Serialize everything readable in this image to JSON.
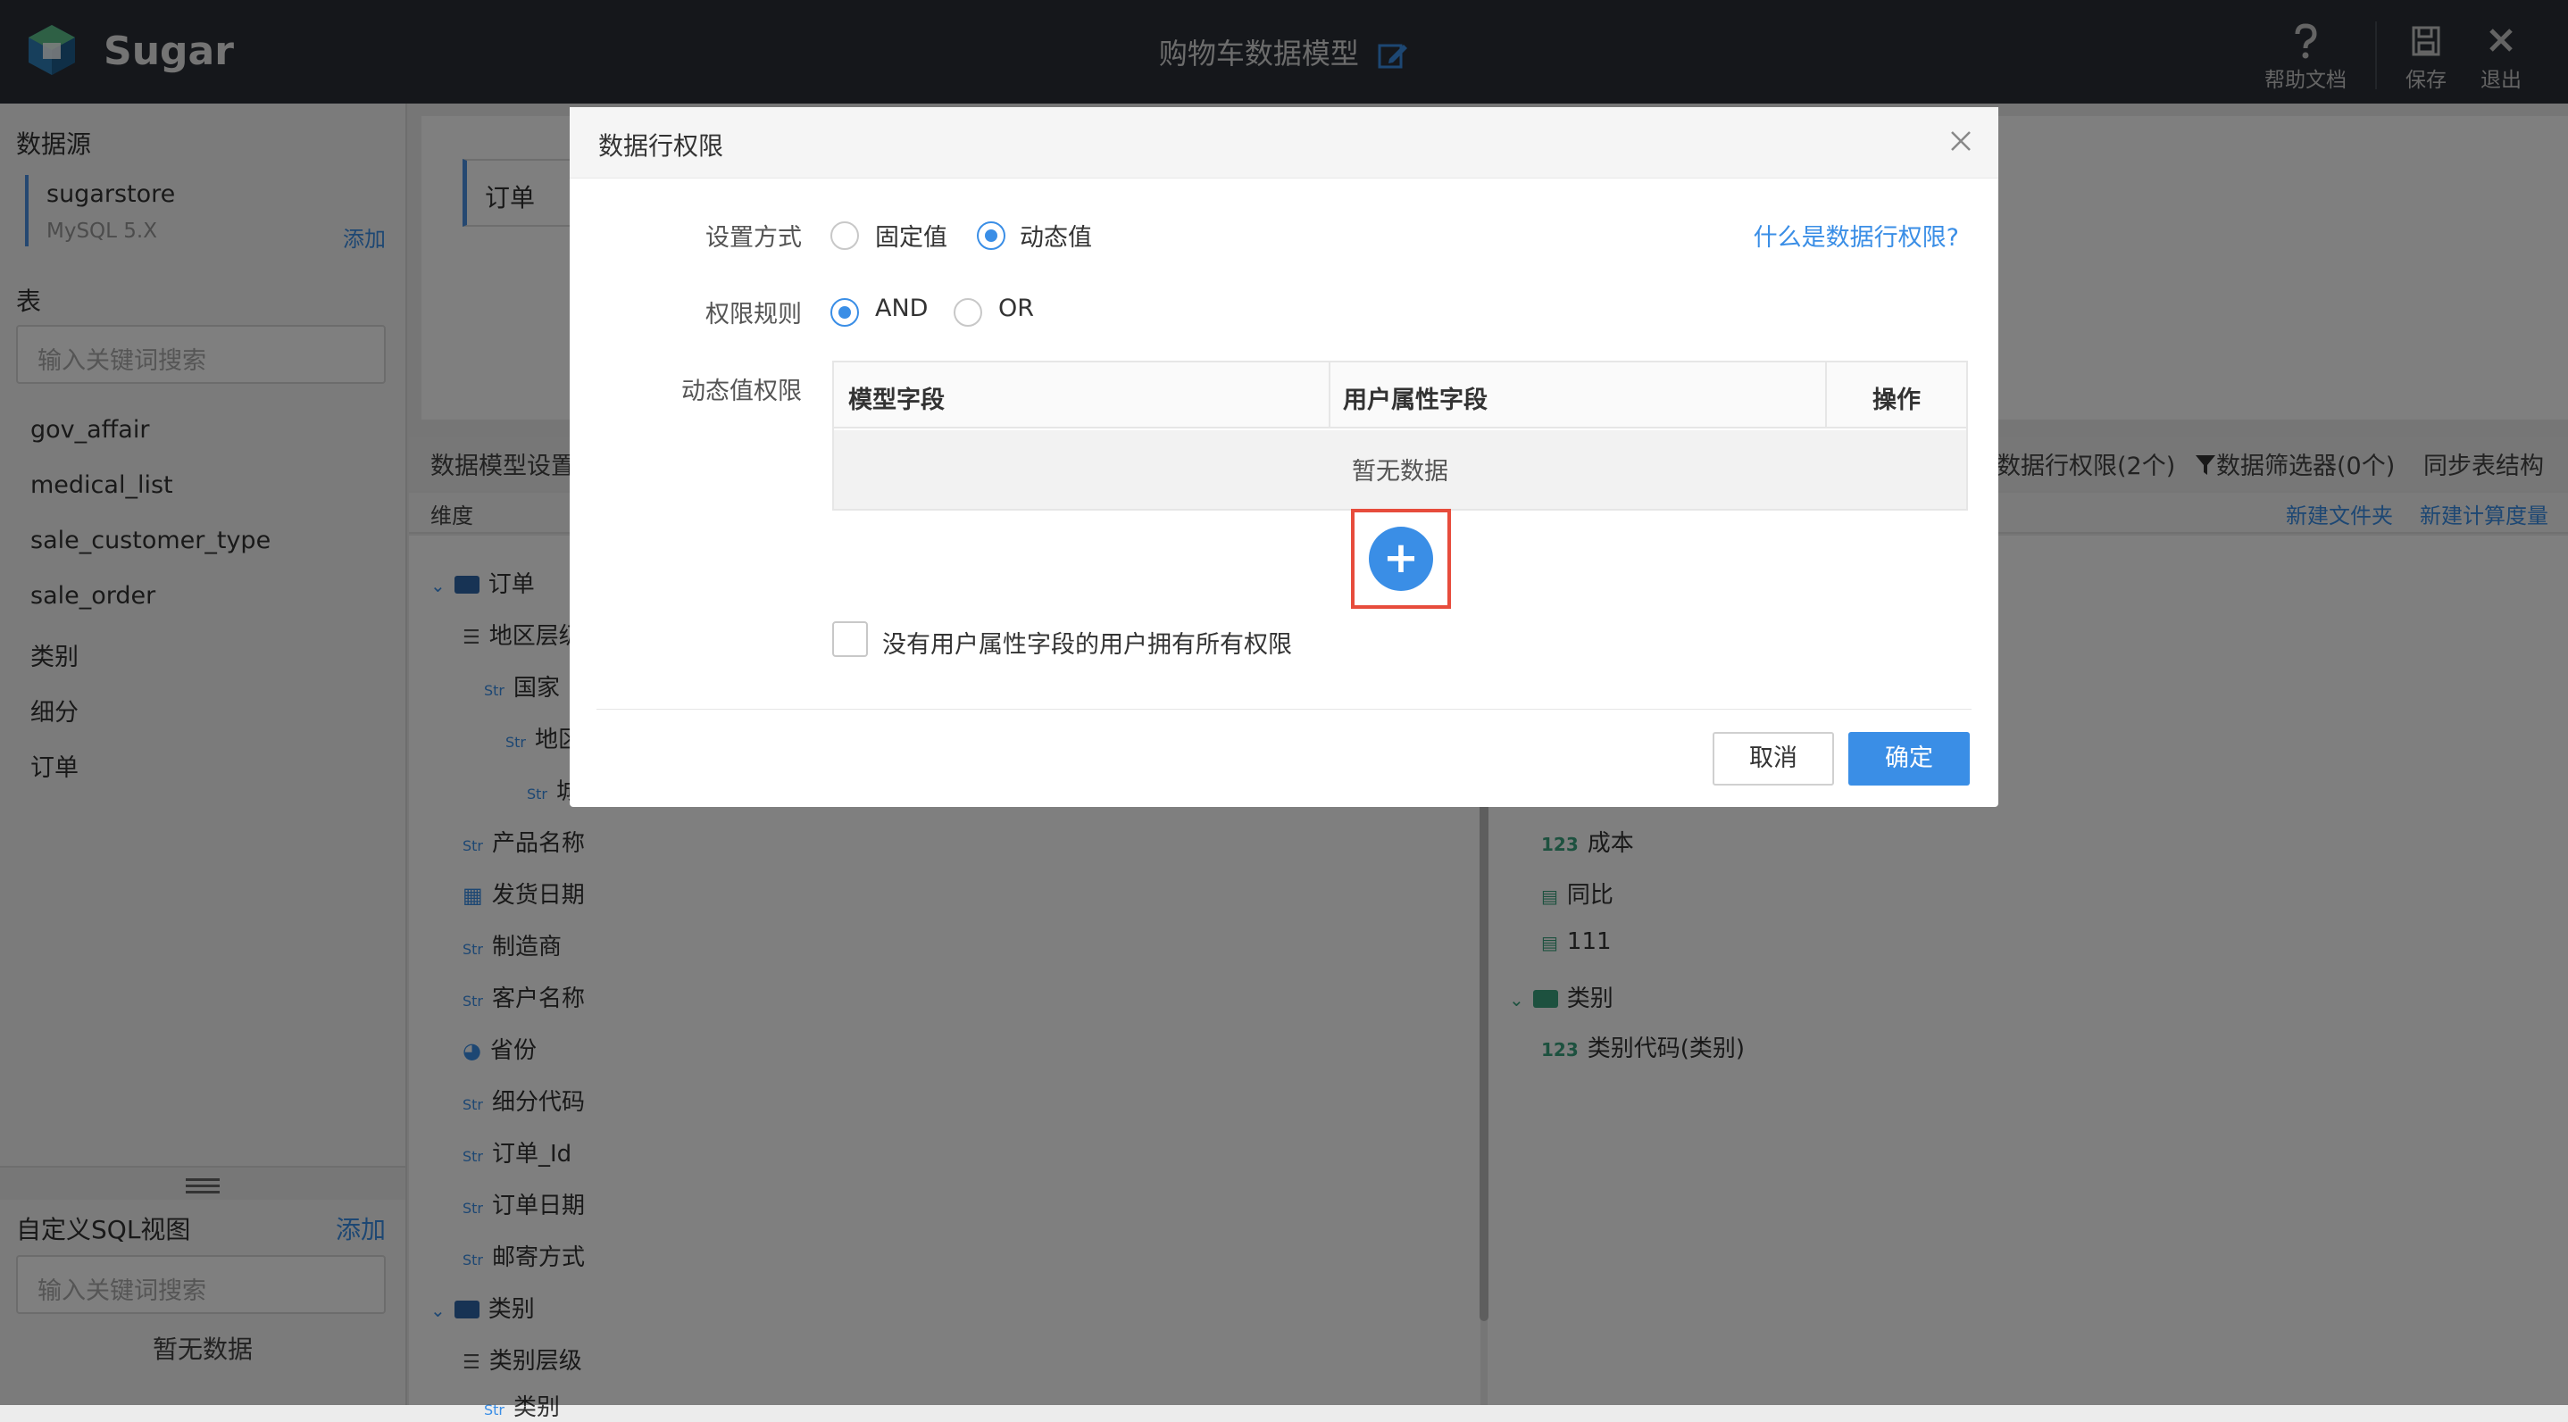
{
  "header": {
    "brand": "Sugar",
    "model_title": "购物车数据模型",
    "help_label": "帮助文档",
    "save_label": "保存",
    "exit_label": "退出"
  },
  "sidebar": {
    "datasource_heading": "数据源",
    "datasource_name": "sugarstore",
    "datasource_type": "MySQL 5.X",
    "datasource_add": "添加",
    "table_heading": "表",
    "table_search_placeholder": "输入关键词搜索",
    "tables": [
      "gov_affair",
      "medical_list",
      "sale_customer_type",
      "sale_order",
      "类别",
      "细分",
      "订单"
    ],
    "sql_heading": "自定义SQL视图",
    "sql_add": "添加",
    "sql_search_placeholder": "输入关键词搜索",
    "sql_empty": "暂无数据"
  },
  "main": {
    "tab": "订单",
    "settings_label": "数据模型设置",
    "row_perm": "数据行权限(2个)",
    "filter": "数据筛选器(0个)",
    "sync": "同步表结构",
    "dimension_label": "维度",
    "new_folder": "新建文件夹",
    "new_calc": "新建计算度量",
    "left_tree": {
      "order_folder": "订单",
      "region_hier": "地区层级",
      "country": "国家",
      "region": "地区",
      "city": "城市",
      "product": "产品名称",
      "ship_date": "发货日期",
      "maker": "制造商",
      "customer": "客户名称",
      "province": "省份",
      "segment_code": "细分代码",
      "order_id": "订单_Id",
      "order_date": "订单日期",
      "ship_mode": "邮寄方式",
      "category_folder": "类别",
      "category_hier": "类别层级",
      "category": "类别"
    },
    "right_tree": {
      "cost": "成本",
      "yoy": "同比",
      "n111": "111",
      "category_folder": "类别",
      "category_code": "类别代码(类别)"
    }
  },
  "modal": {
    "title": "数据行权限",
    "mode_label": "设置方式",
    "mode_fixed": "固定值",
    "mode_dynamic": "动态值",
    "selected_mode": "动态值",
    "help_link": "什么是数据行权限?",
    "rule_label": "权限规则",
    "rule_and": "AND",
    "rule_or": "OR",
    "selected_rule": "AND",
    "dynamic_label": "动态值权限",
    "columns": [
      "模型字段",
      "用户属性字段",
      "操作"
    ],
    "empty": "暂无数据",
    "add_symbol": "+",
    "checkbox_label": "没有用户属性字段的用户拥有所有权限",
    "checkbox_checked": false,
    "cancel": "取消",
    "ok": "确定"
  },
  "colors": {
    "accent": "#3a8ee6",
    "topbar": "#2b2f36",
    "highlight": "#e74c3c"
  }
}
